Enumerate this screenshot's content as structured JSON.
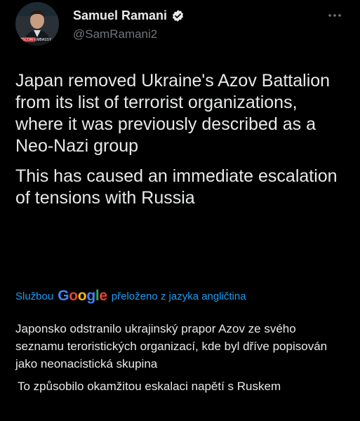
{
  "author": {
    "display_name": "Samuel Ramani",
    "handle": "@SamRamani2",
    "avatar_caption": "MOSCOW EMBASSY"
  },
  "icons": {
    "verified": "verified-badge-icon",
    "more": "more-options-icon"
  },
  "tweet": {
    "paragraphs": [
      "Japan removed Ukraine's Azov Battalion from its list of terrorist organizations, where it was previously described as a Neo-Nazi group",
      "This has caused an immediate escalation of tensions with Russia"
    ]
  },
  "translation": {
    "prefix": "Službou",
    "provider_letters": [
      "G",
      "o",
      "o",
      "g",
      "l",
      "e"
    ],
    "suffix": "přeloženo z jazyka angličtina",
    "paragraphs": [
      "Japonsko odstranilo ukrajinský prapor Azov ze svého seznamu teroristických organizací, kde byl dříve popisován jako neonacistická skupina",
      "To způsobilo okamžitou eskalaci napětí s Ruskem"
    ]
  },
  "colors": {
    "background": "#000000",
    "text": "#e7e9ea",
    "secondary": "#71767b",
    "link": "#1d9bf0",
    "verified": "#1d9bf0"
  }
}
